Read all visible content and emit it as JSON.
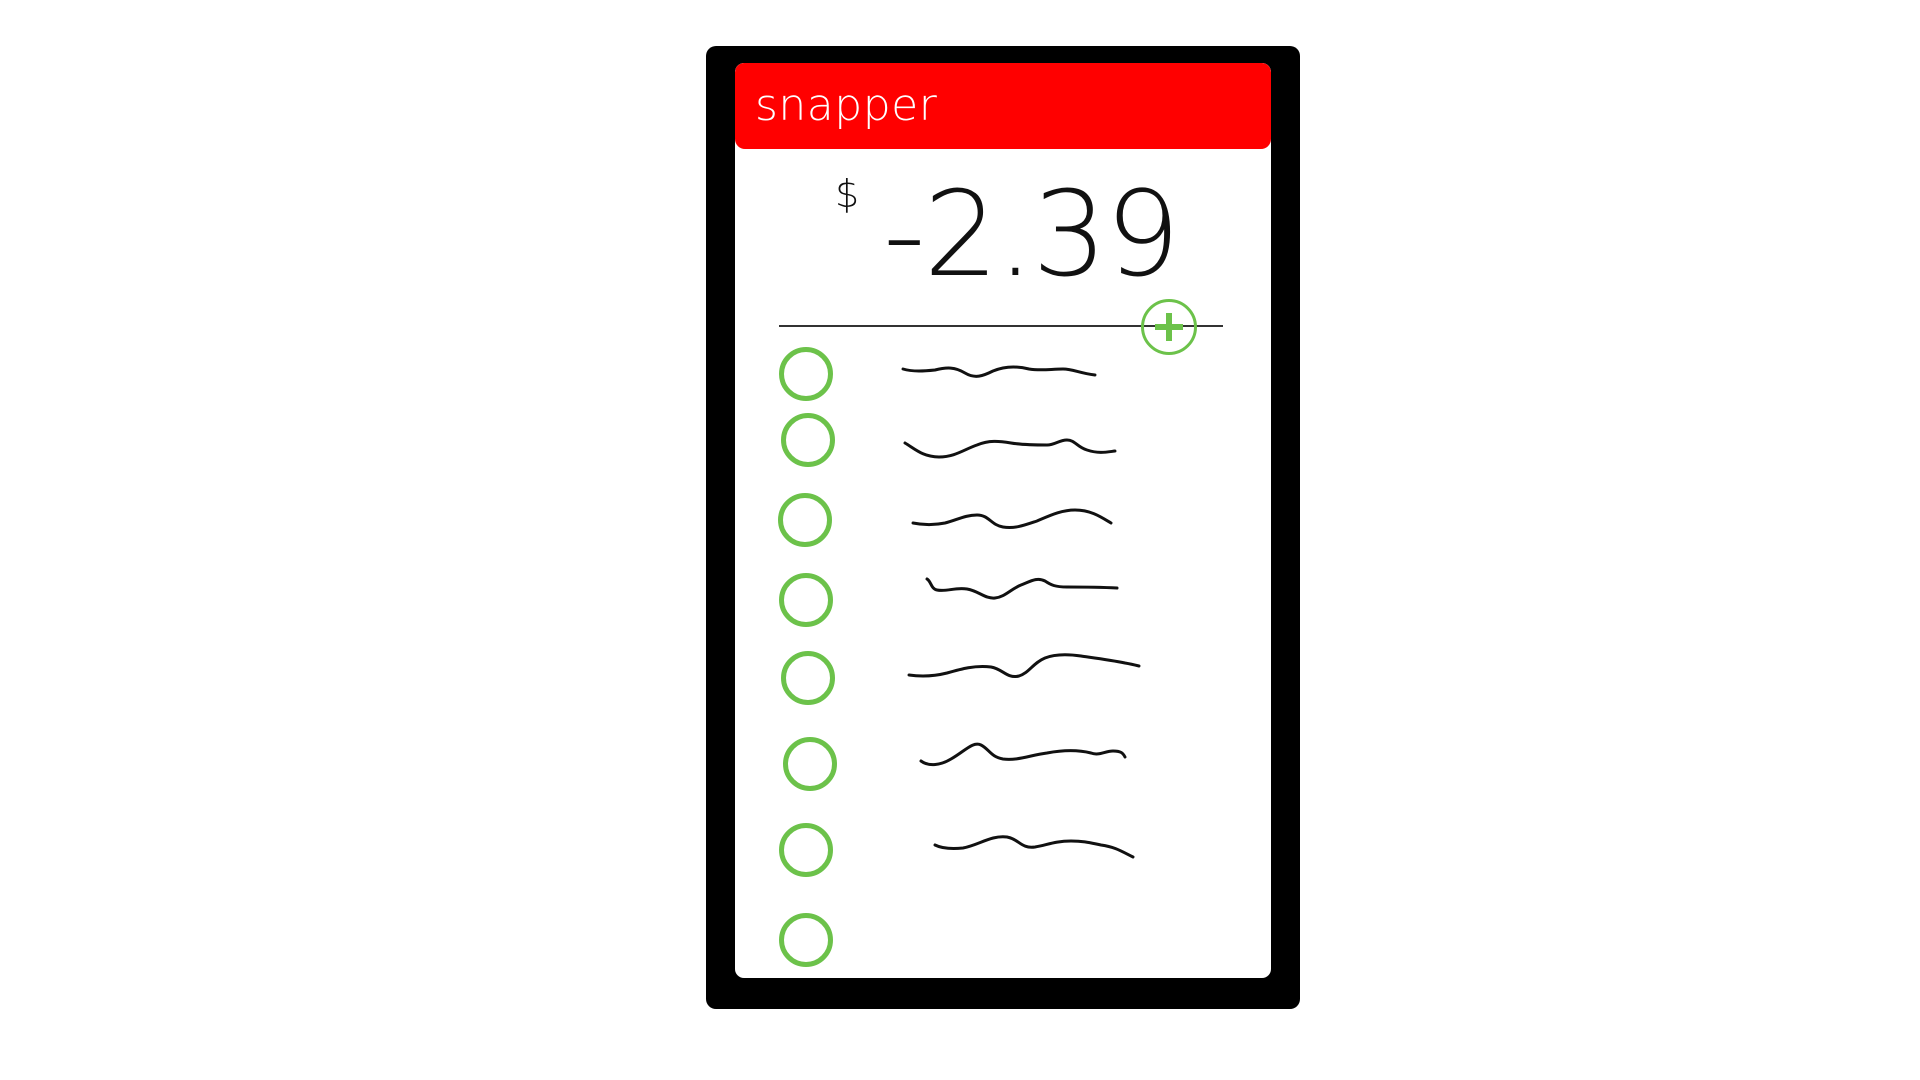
{
  "app": {
    "title": "snapper"
  },
  "balance": {
    "currency_symbol": "$",
    "amount": "-2.39"
  },
  "add_button": {
    "icon": "plus-icon"
  },
  "list": {
    "item_count_visible": 8,
    "items": [
      {
        "checked": false,
        "text": ""
      },
      {
        "checked": false,
        "text": ""
      },
      {
        "checked": false,
        "text": ""
      },
      {
        "checked": false,
        "text": ""
      },
      {
        "checked": false,
        "text": ""
      },
      {
        "checked": false,
        "text": ""
      },
      {
        "checked": false,
        "text": ""
      },
      {
        "checked": false,
        "text": ""
      }
    ]
  },
  "colors": {
    "title_bar": "#ff0000",
    "device_frame": "#000000",
    "accent_green": "#6cc24a",
    "text": "#111111"
  }
}
